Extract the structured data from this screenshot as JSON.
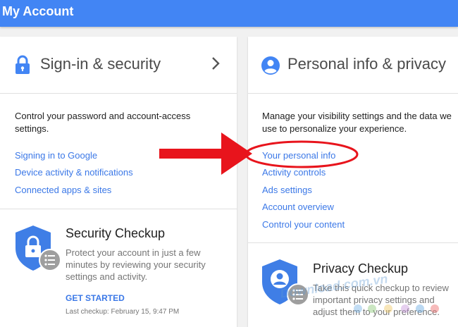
{
  "header": {
    "title": "My Account",
    "bg_color": "#4285f4"
  },
  "signin_card": {
    "title": "Sign-in & security",
    "description": "Control your password and account-access settings.",
    "links": [
      "Signing in to Google",
      "Device activity & notifications",
      "Connected apps & sites"
    ],
    "checkup": {
      "title": "Security Checkup",
      "text": "Protect your account in just a few minutes by reviewing your security settings and activity.",
      "button": "GET STARTED",
      "last_checkup": "Last checkup: February 15, 9:47 PM"
    }
  },
  "privacy_card": {
    "title": "Personal info & privacy",
    "description": "Manage your visibility settings and the data we use to personalize your experience.",
    "links": [
      "Your personal info",
      "Activity controls",
      "Ads settings",
      "Account overview",
      "Control your content"
    ],
    "checkup": {
      "title": "Privacy Checkup",
      "text": "Take this quick checkup to review important privacy settings and adjust them to your preference."
    }
  },
  "watermark": "Download.com.vn",
  "annotation_color": "#e8141c",
  "link_color": "#3b78e7",
  "icons": [
    "lock-icon",
    "chevron-right-icon",
    "person-icon",
    "shield-lock-icon",
    "list-badge-icon",
    "shield-person-icon"
  ]
}
